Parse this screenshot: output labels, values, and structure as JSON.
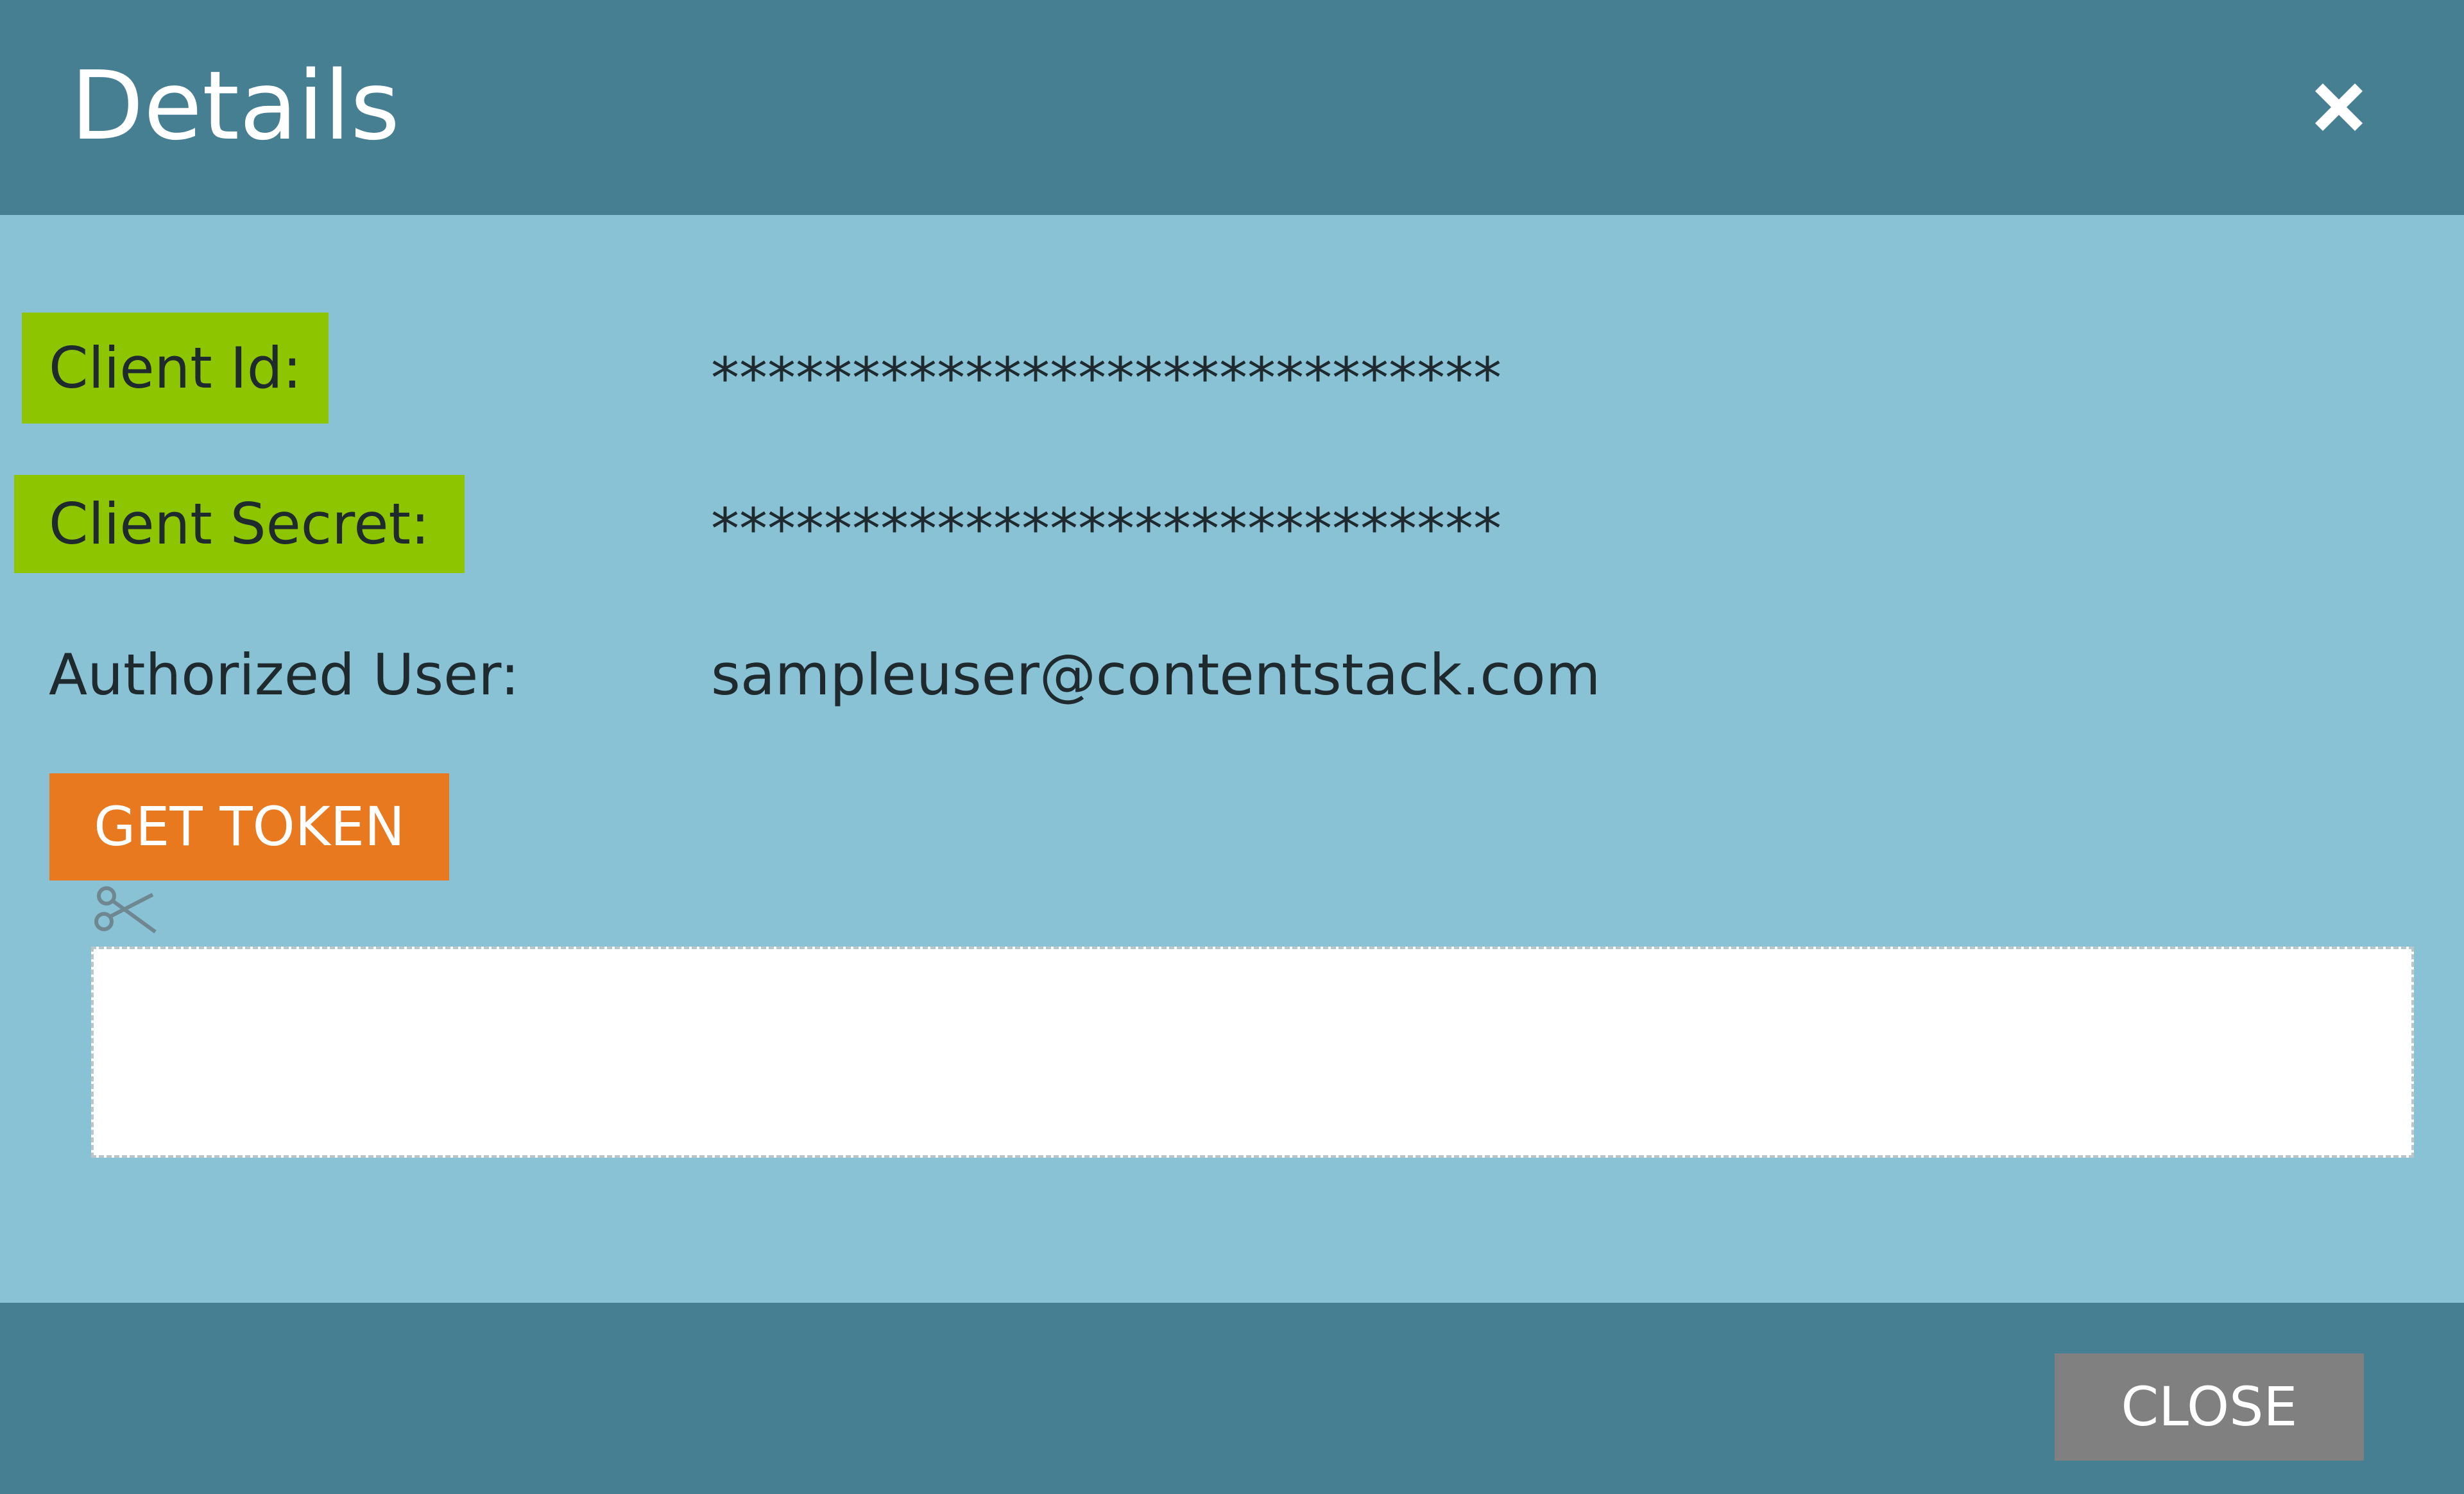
{
  "dialog": {
    "title": "Details",
    "close_icon": "close-icon"
  },
  "fields": {
    "client_id": {
      "label": "Client Id:",
      "value": "****************************"
    },
    "client_secret": {
      "label": "Client Secret:",
      "value": "****************************"
    },
    "authorized_user": {
      "label": "Authorized User:",
      "value": "sampleuser@contentstack.com"
    }
  },
  "actions": {
    "get_token_label": "GET TOKEN",
    "close_label": "CLOSE"
  },
  "token": {
    "value": "",
    "copy_icon": "scissors-icon"
  },
  "colors": {
    "header": "#467f92",
    "body": "#89c2d5",
    "highlight": "#8dc500",
    "get_token": "#e8791f",
    "close": "#808080"
  }
}
